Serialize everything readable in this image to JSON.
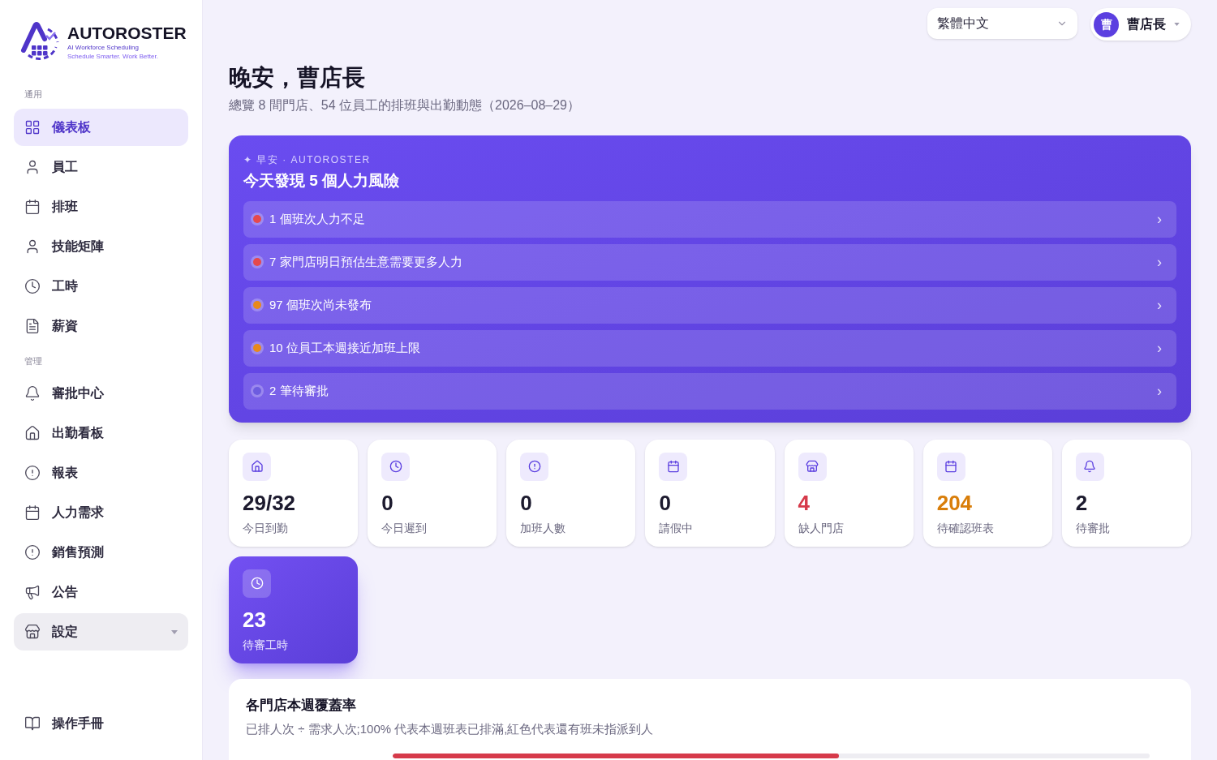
{
  "brand": {
    "name": "AUTOROSTER",
    "tagline": "AI Workforce Scheduling",
    "slogan": "Schedule Smarter. Work Better."
  },
  "sidebar": {
    "sections": [
      {
        "label": "通用",
        "items": [
          {
            "label": "儀表板",
            "selected": true
          },
          {
            "label": "員工",
            "selected": false
          },
          {
            "label": "排班",
            "selected": false
          },
          {
            "label": "技能矩陣",
            "selected": false
          },
          {
            "label": "工時",
            "selected": false
          },
          {
            "label": "薪資",
            "selected": false
          }
        ]
      },
      {
        "label": "管理",
        "items": [
          {
            "label": "審批中心",
            "selected": false
          },
          {
            "label": "出勤看板",
            "selected": false
          },
          {
            "label": "報表",
            "selected": false
          },
          {
            "label": "人力需求",
            "selected": false
          },
          {
            "label": "銷售預測",
            "selected": false
          },
          {
            "label": "公告",
            "selected": false
          },
          {
            "label": "設定",
            "selected": false,
            "expandable": true
          }
        ]
      }
    ],
    "footer": {
      "label": "操作手冊"
    }
  },
  "header": {
    "language": "繁體中文",
    "user": {
      "initial": "曹",
      "name": "曹店長"
    }
  },
  "greeting": {
    "title": "晚安，曹店長",
    "subtitle": "總覽 8 間門店、54 位員工的排班與出勤動態（2026–08–29）"
  },
  "banner": {
    "eyebrow": "✦ 早安 · AUTOROSTER",
    "title": "今天發現 5 個人力風險",
    "items": [
      {
        "text": "1 個班次人力不足",
        "color": "#e5484d"
      },
      {
        "text": "7 家門店明日預估生意需要更多人力",
        "color": "#e5484d"
      },
      {
        "text": "97 個班次尚未發布",
        "color": "#e8891c"
      },
      {
        "text": "10 位員工本週接近加班上限",
        "color": "#e8891c"
      },
      {
        "text": "2 筆待審批",
        "color": "#6d5ce0"
      }
    ],
    "chevron": "›"
  },
  "stats": [
    {
      "value": "29/32",
      "label": "今日到勤",
      "color": "#1c1a2e",
      "featured": false
    },
    {
      "value": "0",
      "label": "今日遲到",
      "color": "#1c1a2e",
      "featured": false
    },
    {
      "value": "0",
      "label": "加班人數",
      "color": "#1c1a2e",
      "featured": false
    },
    {
      "value": "0",
      "label": "請假中",
      "color": "#1c1a2e",
      "featured": false
    },
    {
      "value": "4",
      "label": "缺人門店",
      "color": "#d63a4a",
      "featured": false
    },
    {
      "value": "204",
      "label": "待確認班表",
      "color": "#d97e0a",
      "featured": false
    },
    {
      "value": "2",
      "label": "待審批",
      "color": "#1c1a2e",
      "featured": false
    },
    {
      "value": "23",
      "label": "待審工時",
      "color": "#ffffff",
      "featured": true
    }
  ],
  "coverage": {
    "title": "各門店本週覆蓋率",
    "description": "已排人次 ÷ 需求人次;100% 代表本週班表已排滿,紅色代表還有班未指派到人",
    "rows": [
      {
        "level": 0.59
      }
    ]
  }
}
